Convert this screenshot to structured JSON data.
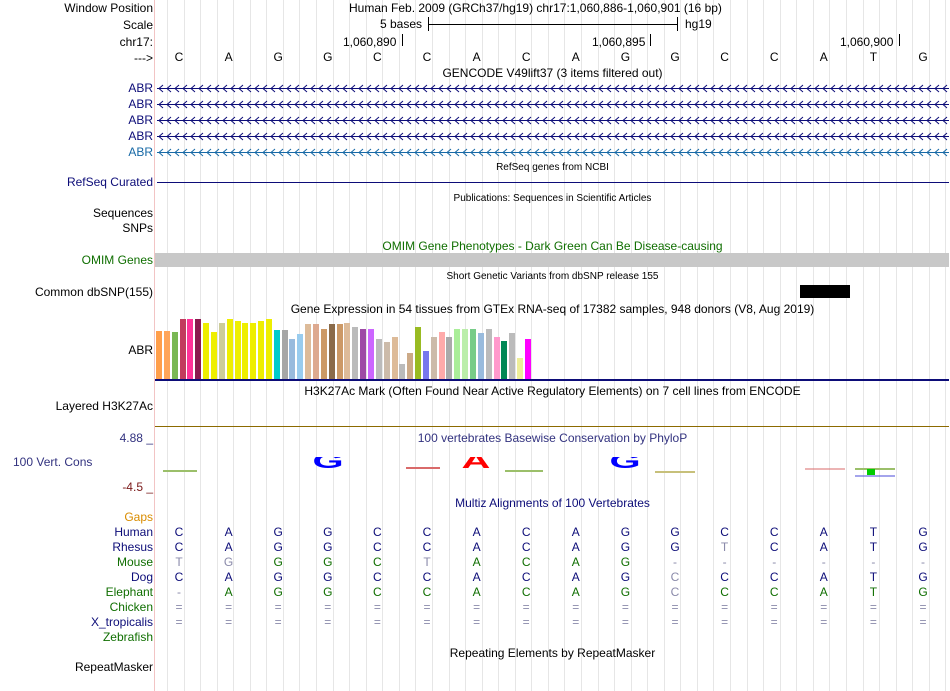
{
  "header": {
    "window_position_label": "Window Position",
    "scale_label": "Scale",
    "chrom_label": "chr17:",
    "strand_label": "--->",
    "assembly_text": "Human Feb. 2009 (GRCh37/hg19)   chr17:1,060,886-1,060,901 (16 bp)",
    "scale_text": "5 bases",
    "scale_db": "hg19",
    "positions": [
      "1,060,890",
      "1,060,895",
      "1,060,900"
    ]
  },
  "bases": [
    "C",
    "A",
    "G",
    "G",
    "C",
    "C",
    "A",
    "C",
    "A",
    "G",
    "G",
    "C",
    "C",
    "A",
    "T",
    "G"
  ],
  "gencode": {
    "title": "GENCODE V49lift37 (3 items filtered out)",
    "items": [
      "ABR",
      "ABR",
      "ABR",
      "ABR",
      "ABR"
    ],
    "color": "#0c0c78",
    "last_color": "#1769a6"
  },
  "refseq": {
    "title": "RefSeq genes from NCBI",
    "label": "RefSeq Curated",
    "color": "#0c0c78"
  },
  "publications": {
    "title": "Publications: Sequences in Scientific Articles",
    "labels": [
      "Sequences",
      "SNPs"
    ]
  },
  "omim": {
    "title": "OMIM Gene Phenotypes - Dark Green Can Be Disease-causing",
    "label": "OMIM Genes",
    "color": "#0f6e00",
    "bar_color": "#c8c8c8"
  },
  "dbsnp": {
    "title": "Short Genetic Variants from dbSNP release 155",
    "label": "Common dbSNP(155)"
  },
  "gtex": {
    "title": "Gene Expression in 54 tissues from GTEx RNA-seq of 17382 samples, 948 donors (V8, Aug 2019)",
    "label": "ABR",
    "tissue_colors": [
      "#ff9e4a",
      "#ffa559",
      "#7ab854",
      "#c23b5d",
      "#ff3399",
      "#8b1a4f",
      "#eeee00",
      "#eeee00",
      "#cccc99",
      "#eeee00",
      "#eeee00",
      "#eeee00",
      "#eeee00",
      "#eeee00",
      "#eeee00",
      "#00cccc",
      "#a6a6a6",
      "#99bbdd",
      "#99ccee",
      "#ddbb99",
      "#dda98f",
      "#cc9966",
      "#8b6b4a",
      "#cc9966",
      "#ddbb99",
      "#bbbbbb",
      "#9e4aa6",
      "#cc66ff",
      "#bbbbbb",
      "#ccbbaa",
      "#ddbb99",
      "#bbbbbb",
      "#ccaa88",
      "#99bb22",
      "#7777ee",
      "#ccbbaa",
      "#ffaaaa",
      "#aaaaaa",
      "#aaee99",
      "#bbeeaa",
      "#77cc88",
      "#99bbdd",
      "#bbbbbb",
      "#ff99cc",
      "#008855",
      "#bbbbbb",
      "#eeee99",
      "#ff00ff"
    ],
    "tissue_values": [
      0.78,
      0.78,
      0.76,
      0.97,
      0.97,
      0.97,
      0.91,
      0.76,
      0.91,
      0.97,
      0.94,
      0.91,
      0.91,
      0.94,
      0.97,
      0.79,
      0.79,
      0.65,
      0.72,
      0.88,
      0.88,
      0.81,
      0.88,
      0.88,
      0.91,
      0.84,
      0.81,
      0.81,
      0.65,
      0.59,
      0.68,
      0.24,
      0.42,
      0.84,
      0.45,
      0.68,
      0.76,
      0.68,
      0.81,
      0.81,
      0.81,
      0.74,
      0.81,
      0.68,
      0.61,
      0.74,
      0.34,
      0.65
    ]
  },
  "h3k27ac": {
    "title": "H3K27Ac Mark (Often Found Near Active Regulatory Elements) on 7 cell lines from ENCODE",
    "label": "Layered H3K27Ac"
  },
  "phylop": {
    "title": "100 vertebrates Basewise Conservation by PhyloP",
    "label": "100 Vert. Cons",
    "max": "4.88 _",
    "min": "-4.5 _",
    "label_color": "#32327f",
    "min_color": "#7a1919"
  },
  "multiz": {
    "title": "Multiz Alignments of 100 Vertebrates",
    "gaps_label": "Gaps",
    "gaps_color": "#d98c00",
    "species": [
      {
        "name": "Human",
        "color": "#0c0c78",
        "seq": [
          "C",
          "A",
          "G",
          "G",
          "C",
          "C",
          "A",
          "C",
          "A",
          "G",
          "G",
          "C",
          "C",
          "A",
          "T",
          "G"
        ]
      },
      {
        "name": "Rhesus",
        "color": "#0c0c78",
        "seq": [
          "C",
          "A",
          "G",
          "G",
          "C",
          "C",
          "A",
          "C",
          "A",
          "G",
          "G",
          "T",
          "C",
          "A",
          "T",
          "G"
        ]
      },
      {
        "name": "Mouse",
        "color": "#0f6e00",
        "seq": [
          "T",
          "G",
          "G",
          "G",
          "C",
          "T",
          "A",
          "C",
          "A",
          "G",
          "-",
          "-",
          "-",
          "-",
          "-",
          "-"
        ]
      },
      {
        "name": "Dog",
        "color": "#0c0c78",
        "seq": [
          "C",
          "A",
          "G",
          "G",
          "C",
          "C",
          "A",
          "C",
          "A",
          "G",
          "C",
          "C",
          "C",
          "A",
          "T",
          "G"
        ]
      },
      {
        "name": "Elephant",
        "color": "#0f6e00",
        "seq": [
          "-",
          "A",
          "G",
          "G",
          "C",
          "C",
          "A",
          "C",
          "A",
          "G",
          "C",
          "C",
          "C",
          "A",
          "T",
          "G"
        ]
      },
      {
        "name": "Chicken",
        "color": "#0f6e00",
        "seq": [
          "=",
          "=",
          "=",
          "=",
          "=",
          "=",
          "=",
          "=",
          "=",
          "=",
          "=",
          "=",
          "=",
          "=",
          "=",
          "="
        ]
      },
      {
        "name": "X_tropicalis",
        "color": "#0c0c78",
        "seq": [
          "=",
          "=",
          "=",
          "=",
          "=",
          "=",
          "=",
          "=",
          "=",
          "=",
          "=",
          "=",
          "=",
          "=",
          "=",
          "="
        ]
      },
      {
        "name": "Zebrafish",
        "color": "#0f6e00",
        "seq": [
          "",
          "",
          "",
          "",
          "",
          "",
          "",
          "",
          "",
          "",
          "",
          "",
          "",
          "",
          "",
          ""
        ]
      }
    ]
  },
  "repeatmasker": {
    "title": "Repeating Elements by RepeatMasker",
    "label": "RepeatMasker"
  }
}
